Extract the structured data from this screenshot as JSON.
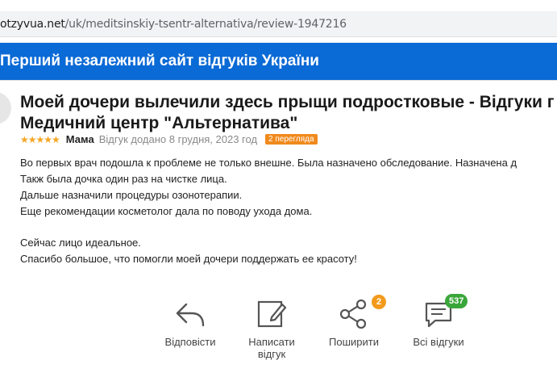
{
  "browser": {
    "url_host": "otzyvua.net",
    "url_path": "/uk/meditsinskiy-tsentr-alternativa/review-1947216"
  },
  "banner": {
    "title": "Перший незалежний сайт відгуків України"
  },
  "review": {
    "title_line1": "Моей дочери вылечили здесь прыщи подростковые - Відгуки г",
    "title_line2": "Медичний центр \"Альтернатива\"",
    "stars": "★★★★★",
    "rating": 5,
    "author": "Мама",
    "date": "Відгук додано 8 грудня, 2023 год",
    "views": "2 перегляда",
    "paragraph1": [
      "Во первых врач подошла к проблеме не только внешне. Была назначено обследование. Назначена д",
      "Такж была дочка один раз на чистке лица.",
      "Дальше назначили процедуры озонотерапии.",
      "Еще рекомендации косметолог дала по поводу ухода дома."
    ],
    "paragraph2": [
      "Сейчас лицо идеальное.",
      "Спасибо большое, что помогли моей дочери поддержать ее красоту!"
    ]
  },
  "actions": {
    "reply": {
      "label": "Відповісти",
      "icon": "reply-arrow-icon"
    },
    "write": {
      "label_line1": "Написати",
      "label_line2": "відгук",
      "icon": "edit-icon"
    },
    "share": {
      "label": "Поширити",
      "icon": "share-icon",
      "badge": "2"
    },
    "all_reviews": {
      "label": "Всі відгуки",
      "icon": "comment-icon",
      "badge": "537"
    }
  },
  "colors": {
    "banner": "#0a6ad6",
    "stars": "#f5a623",
    "views_badge": "#f08a1d",
    "share_badge": "#f39a1c",
    "reviews_badge": "#3aa63a",
    "icon": "#555555"
  }
}
